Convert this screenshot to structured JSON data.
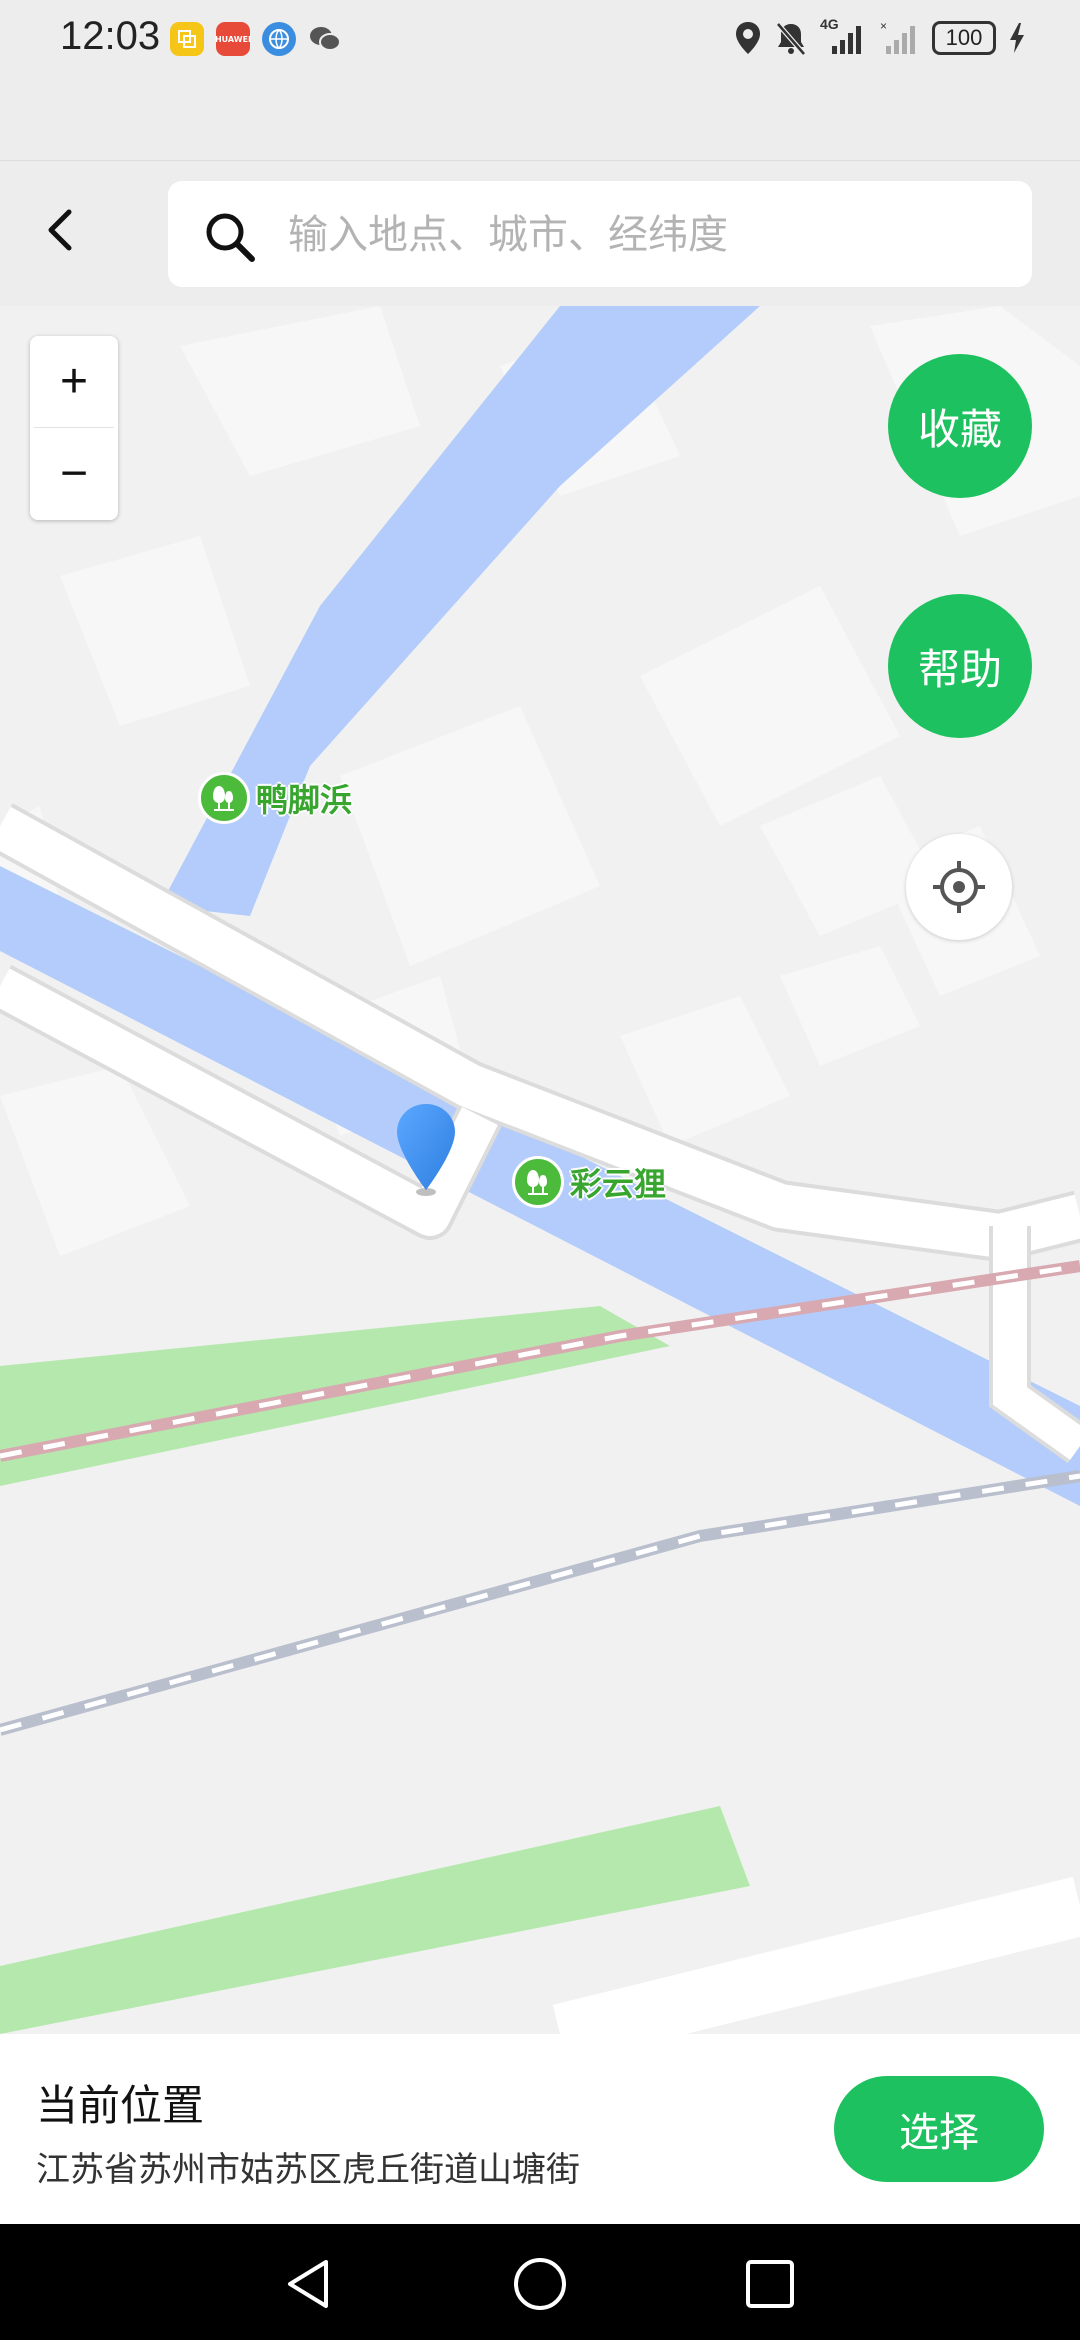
{
  "status_bar": {
    "time": "12:03",
    "apps": [
      {
        "icon": "notes-app-icon",
        "label": "",
        "color": "#f5c518"
      },
      {
        "icon": "huawei-app-icon",
        "label": "HUAWEI",
        "color": "#e84a3a"
      },
      {
        "icon": "browser-app-icon",
        "label": "",
        "color": "#3b8de0"
      },
      {
        "icon": "wechat-icon",
        "label": "",
        "color": "#555555"
      }
    ],
    "network": "4G",
    "battery": "100"
  },
  "header": {
    "back_icon": "chevron-left-icon",
    "search_placeholder": "输入地点、城市、经纬度"
  },
  "map": {
    "zoom_in": "+",
    "zoom_out": "−",
    "favorite_label": "收藏",
    "help_label": "帮助",
    "locate_icon": "crosshair-icon",
    "pois": [
      {
        "name": "鸭脚浜"
      },
      {
        "name": "彩云狸"
      }
    ],
    "marker_icon": "location-pin-icon"
  },
  "current_location": {
    "title": "当前位置",
    "address": "江苏省苏州市姑苏区虎丘街道山塘街",
    "select_label": "选择"
  },
  "colors": {
    "accent_green": "#1ec15f",
    "water": "#b3ccfb",
    "park": "#b5e8ad",
    "pin_blue": "#3d8ef0"
  }
}
